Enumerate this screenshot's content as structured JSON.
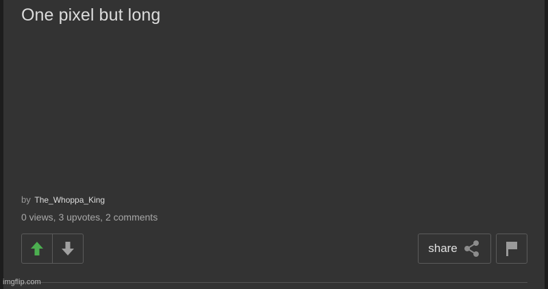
{
  "post": {
    "title": "One pixel but long",
    "by_label": "by",
    "author": "The_Whoppa_King",
    "stats": "0 views, 3 upvotes, 2 comments"
  },
  "actions": {
    "share_label": "share",
    "upvote_icon": "arrow-up-icon",
    "downvote_icon": "arrow-down-icon",
    "share_icon": "share-icon",
    "flag_icon": "flag-icon"
  },
  "colors": {
    "upvote_active": "#4caf50",
    "icon_gray": "#a0a0a0",
    "panel_bg": "#333333"
  },
  "watermark": "imgflip.com"
}
